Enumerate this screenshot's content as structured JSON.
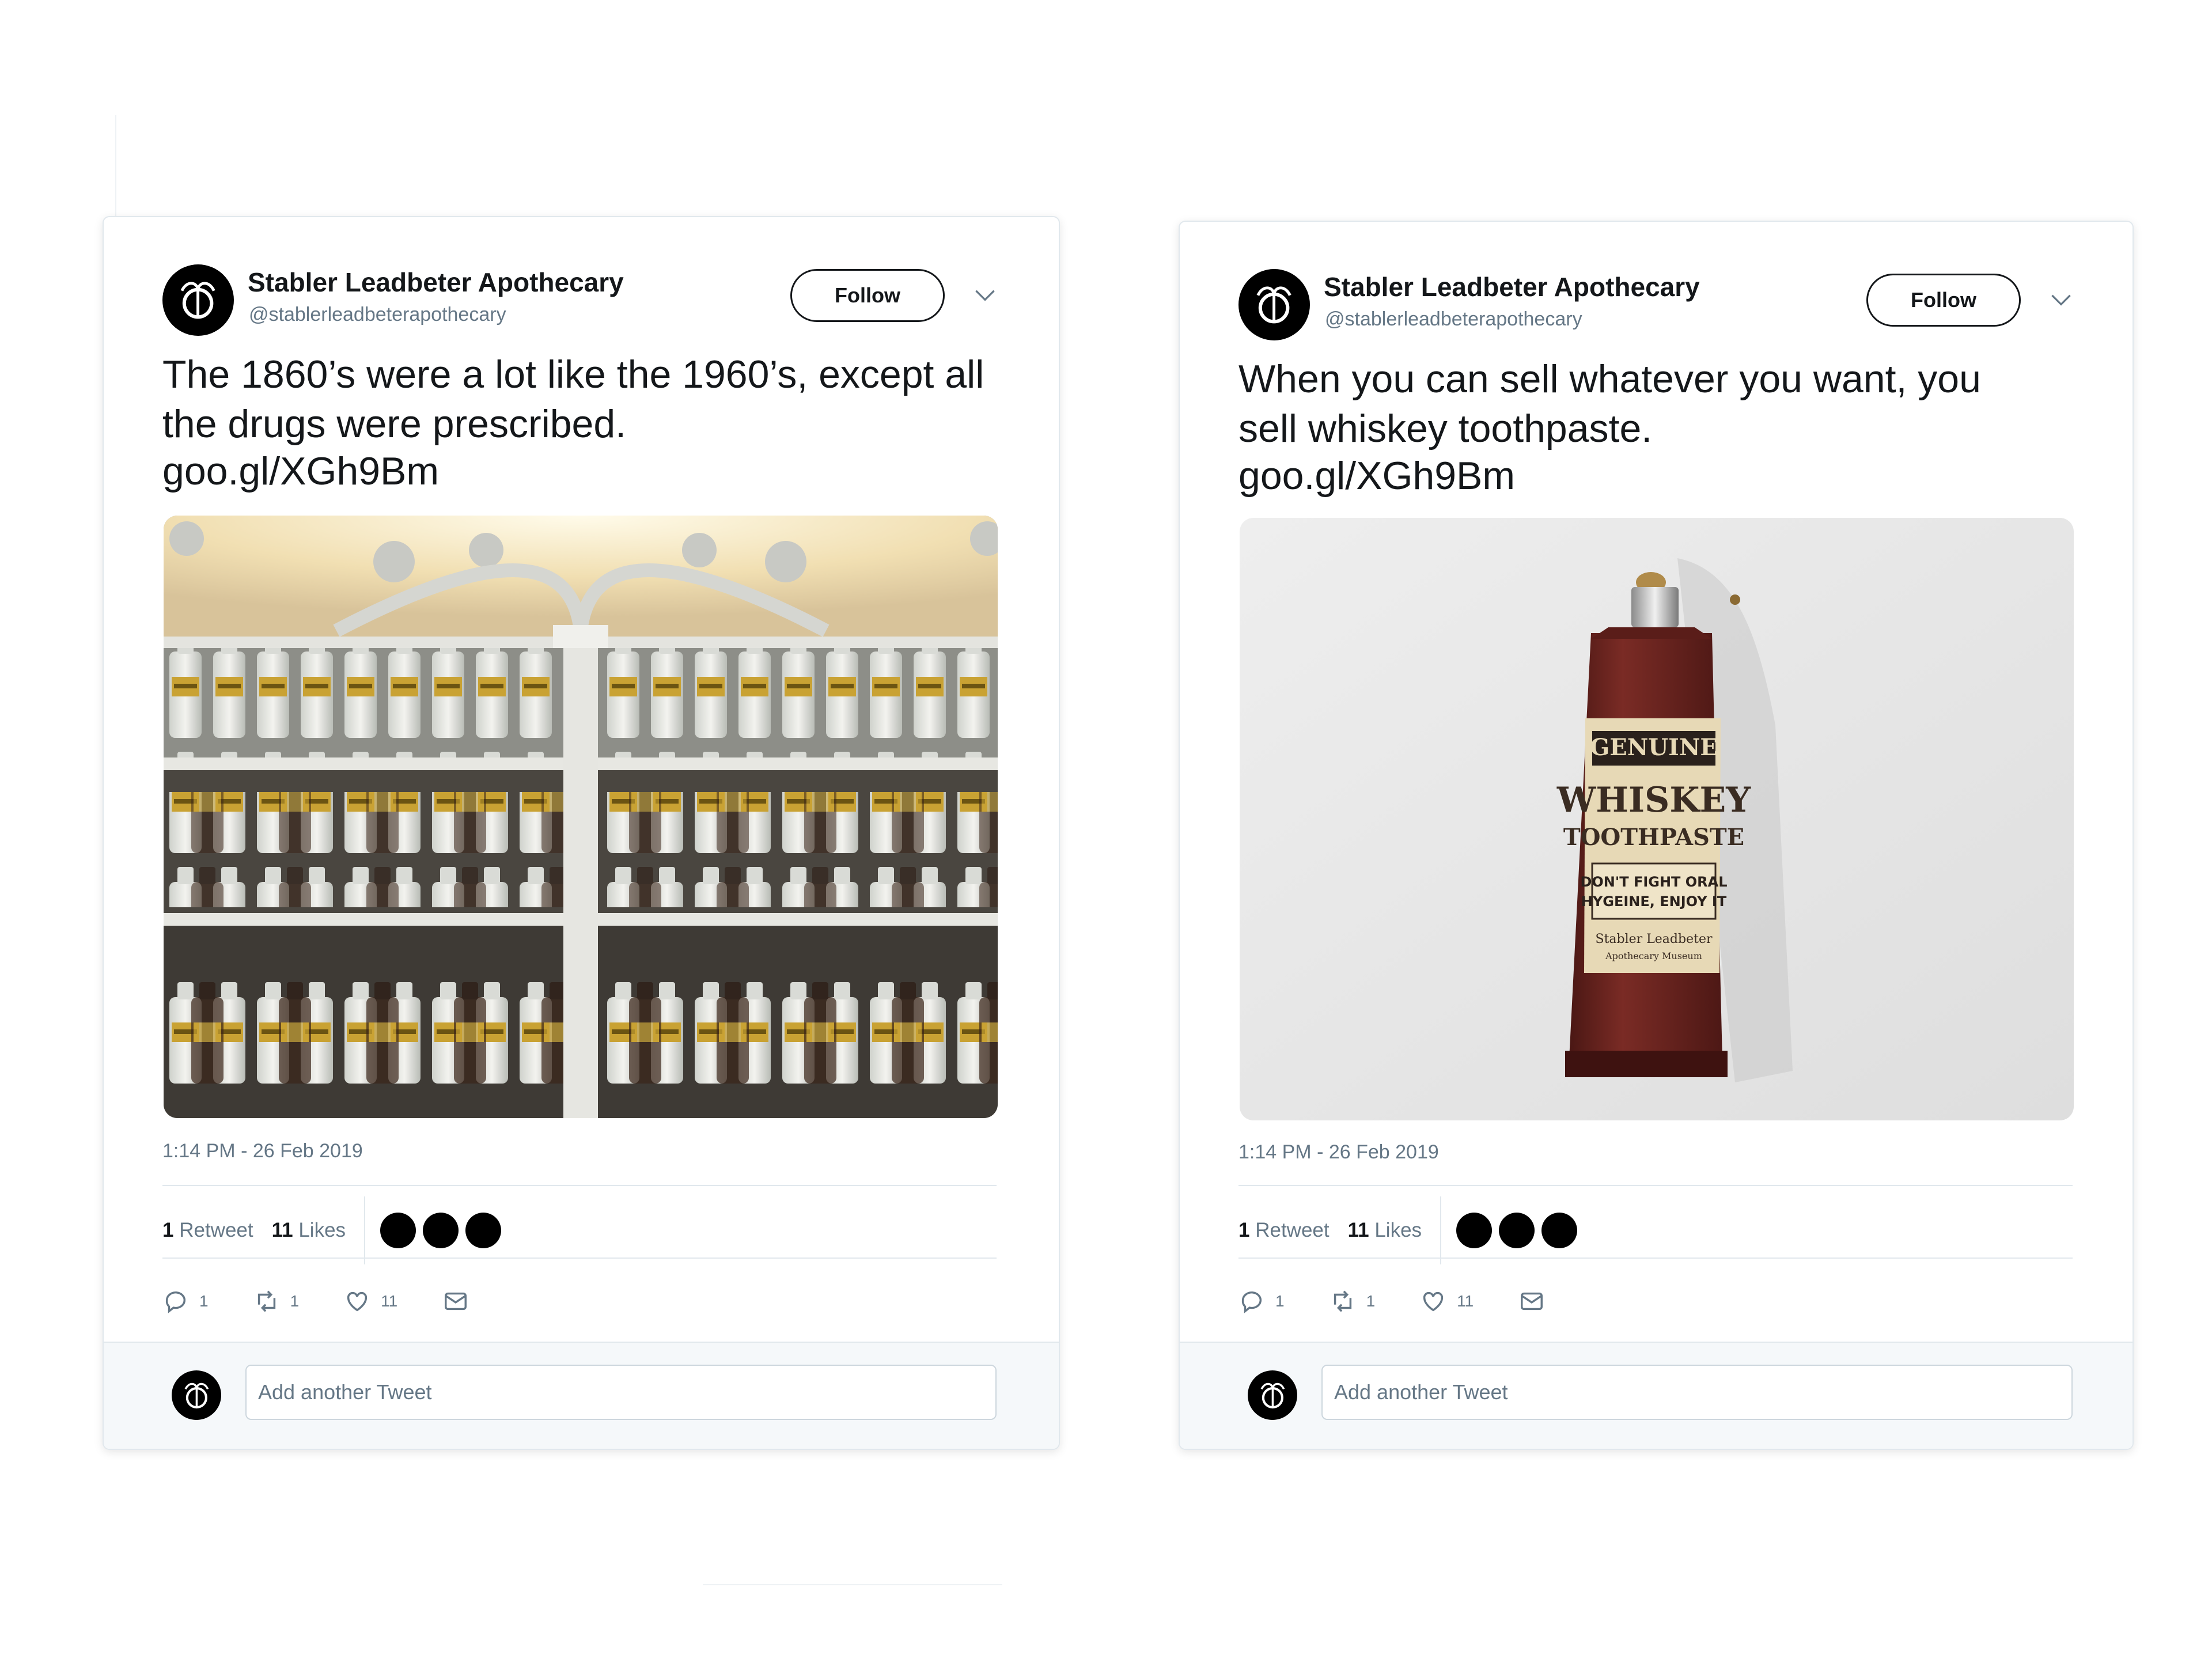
{
  "tweets": [
    {
      "author_name": "Stabler Leadbeter Apothecary",
      "author_handle": "@stablerleadbeterapothecary",
      "follow_label": "Follow",
      "text": "The 1860’s were a lot like the 1960’s, except all the drugs were prescribed.",
      "link": "goo.gl/XGh9Bm",
      "timestamp": "1:14 PM - 26 Feb 2019",
      "retweets": "1",
      "retweets_label": "Retweet",
      "likes": "11",
      "likes_label": "Likes",
      "actions": {
        "reply": "1",
        "retweet": "1",
        "like": "11"
      },
      "reply_placeholder": "Add another Tweet",
      "media": "apothecary-shelves-photo"
    },
    {
      "author_name": "Stabler Leadbeter Apothecary",
      "author_handle": "@stablerleadbeterapothecary",
      "follow_label": "Follow",
      "text": "When you can sell whatever you want, you sell whiskey toothpaste.",
      "link": "goo.gl/XGh9Bm",
      "timestamp": "1:14 PM - 26 Feb 2019",
      "retweets": "1",
      "retweets_label": "Retweet",
      "likes": "11",
      "likes_label": "Likes",
      "actions": {
        "reply": "1",
        "retweet": "1",
        "like": "11"
      },
      "reply_placeholder": "Add another Tweet",
      "media": "whiskey-toothpaste-tube",
      "tube_label": {
        "line1": "GENUINE",
        "line2": "WHISKEY",
        "line3": "TOOTHPASTE",
        "line4": "DON'T FIGHT ORAL",
        "line5": "HYGEINE, ENJOY IT",
        "line6": "Stabler Leadbeter",
        "line7": "Apothecary Museum"
      }
    }
  ],
  "colors": {
    "text": "#14171a",
    "muted": "#657786",
    "border": "#e1e8ed",
    "reply_bg": "#f5f8fa",
    "tube": "#6b2420"
  }
}
